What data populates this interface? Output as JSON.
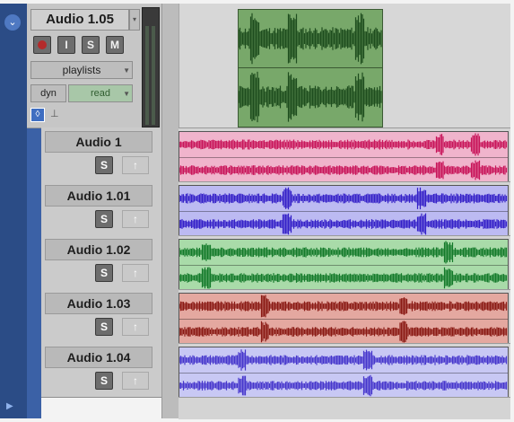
{
  "master_track": {
    "name": "Audio 1.05",
    "buttons": {
      "record": "",
      "input": "I",
      "solo": "S",
      "mute": "M"
    },
    "playlists_label": "playlists",
    "dyn_label": "dyn",
    "automation_mode": "read",
    "lock_icon": "lock-icon",
    "small_marker": "⊥",
    "clip_color": "#78a86a",
    "wave_color": "#1e4d1e"
  },
  "tracks": [
    {
      "name": "Audio 1",
      "solo": "S",
      "up_arrow": "↑",
      "clip_color": "#f0b4cc",
      "wave_color": "#c8155a"
    },
    {
      "name": "Audio 1.01",
      "solo": "S",
      "up_arrow": "↑",
      "clip_color": "#bcbaf2",
      "wave_color": "#3420c8"
    },
    {
      "name": "Audio 1.02",
      "solo": "S",
      "up_arrow": "↑",
      "clip_color": "#a9dba9",
      "wave_color": "#147a2a"
    },
    {
      "name": "Audio 1.03",
      "solo": "S",
      "up_arrow": "↑",
      "clip_color": "#e4a8a0",
      "wave_color": "#8a1a14"
    },
    {
      "name": "Audio 1.04",
      "solo": "S",
      "up_arrow": "↑",
      "clip_color": "#c8c8f4",
      "wave_color": "#4636cc"
    }
  ],
  "accent_colors": {
    "side_strip": "#2b4c86",
    "lock_blue": "#3f6ec1"
  }
}
